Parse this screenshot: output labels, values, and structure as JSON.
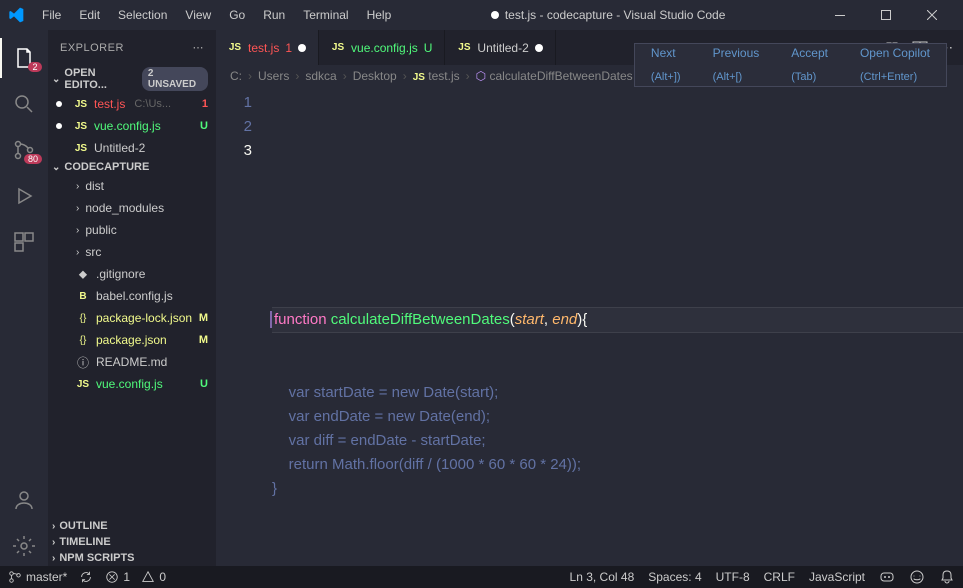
{
  "title": {
    "file": "test.js",
    "project": "codecapture",
    "app": "Visual Studio Code"
  },
  "menu": [
    "File",
    "Edit",
    "Selection",
    "View",
    "Go",
    "Run",
    "Terminal",
    "Help"
  ],
  "activity": {
    "explorer_badge": "2",
    "scm_badge": "80"
  },
  "sidebar": {
    "header": "EXPLORER",
    "openEditors": {
      "label": "OPEN EDITO...",
      "badge": "2 UNSAVED"
    },
    "editors": [
      {
        "icon": "JS",
        "name": "test.js",
        "suffix": "C:\\Us...",
        "mod": "1",
        "cls": "file-err"
      },
      {
        "icon": "JS",
        "name": "vue.config.js",
        "mod": "U",
        "cls": "file-untracked"
      },
      {
        "icon": "JS",
        "name": "Untitled-2",
        "mod": "",
        "cls": ""
      }
    ],
    "project": "CODECAPTURE",
    "tree": [
      {
        "t": "folder",
        "name": "dist"
      },
      {
        "t": "folder",
        "name": "node_modules"
      },
      {
        "t": "folder",
        "name": "public",
        "dot": "teal"
      },
      {
        "t": "folder",
        "name": "src",
        "dot": "teal"
      },
      {
        "t": "file",
        "icon": "⬥",
        "name": ".gitignore"
      },
      {
        "t": "file",
        "icon": "B",
        "name": "babel.config.js",
        "iconCls": "js-i"
      },
      {
        "t": "file",
        "icon": "{}",
        "name": "package-lock.json",
        "mod": "M",
        "cls": "file-mod",
        "iconCls": "json-i"
      },
      {
        "t": "file",
        "icon": "{}",
        "name": "package.json",
        "mod": "M",
        "cls": "file-mod",
        "iconCls": "json-i"
      },
      {
        "t": "file",
        "icon": "ⓘ",
        "name": "README.md"
      },
      {
        "t": "file",
        "icon": "JS",
        "name": "vue.config.js",
        "mod": "U",
        "cls": "file-untracked",
        "iconCls": "js-i"
      }
    ],
    "panels": [
      "OUTLINE",
      "TIMELINE",
      "NPM SCRIPTS"
    ]
  },
  "tabs": [
    {
      "icon": "JS",
      "label": "test.js",
      "mod": "1",
      "cls": "file-err",
      "active": true,
      "dirty": true
    },
    {
      "icon": "JS",
      "label": "vue.config.js",
      "mod": "U",
      "cls": "file-untracked"
    },
    {
      "icon": "JS",
      "label": "Untitled-2",
      "dirty": true
    }
  ],
  "breadcrumbs": [
    "C:",
    "Users",
    "sdkca",
    "Desktop",
    "test.js",
    "calculateDiffBetweenDates"
  ],
  "copilot": [
    {
      "label": "Next",
      "hint": "(Alt+])"
    },
    {
      "label": "Previous",
      "hint": "(Alt+[)"
    },
    {
      "label": "Accept",
      "hint": "(Tab)"
    },
    {
      "label": "Open Copilot",
      "hint": "(Ctrl+Enter)"
    }
  ],
  "code": {
    "lines": [
      1,
      2,
      3
    ],
    "activeLine": 3,
    "sig": {
      "kw": "function",
      "name": "calculateDiffBetweenDates",
      "p1": "start",
      "p2": "end"
    },
    "ghost": [
      "    var startDate = new Date(start);",
      "    var endDate = new Date(end);",
      "    var diff = endDate - startDate;",
      "    return Math.floor(diff / (1000 * 60 * 60 * 24));",
      "}"
    ]
  },
  "status": {
    "branch": "master*",
    "sync": "",
    "errors": "1",
    "warnings": "0",
    "cursor": "Ln 3, Col 48",
    "spaces": "Spaces: 4",
    "enc": "UTF-8",
    "eol": "CRLF",
    "lang": "JavaScript"
  }
}
